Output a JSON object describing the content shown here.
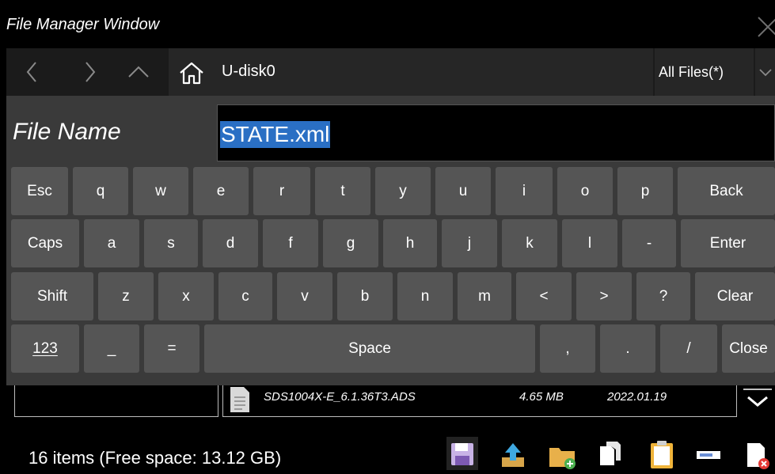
{
  "window": {
    "title": "File Manager Window",
    "close_icon": "close-icon"
  },
  "nav": {
    "back_icon": "chevron-left-icon",
    "forward_icon": "chevron-right-icon",
    "up_icon": "chevron-up-icon",
    "home_icon": "home-icon",
    "path": "U-disk0",
    "filter": "All Files(*)",
    "filter_icon": "chevron-down-icon"
  },
  "file_name": {
    "label": "File Name",
    "value": "STATE.xml"
  },
  "keyboard": {
    "row1": [
      "Esc",
      "q",
      "w",
      "e",
      "r",
      "t",
      "y",
      "u",
      "i",
      "o",
      "p",
      "Back"
    ],
    "row2": [
      "Caps",
      "a",
      "s",
      "d",
      "f",
      "g",
      "h",
      "j",
      "k",
      "l",
      "-",
      "Enter"
    ],
    "row3": [
      "Shift",
      "z",
      "x",
      "c",
      "v",
      "b",
      "n",
      "m",
      "<",
      ">",
      "?",
      "Clear"
    ],
    "row4": [
      "123",
      "_",
      "=",
      "Space",
      ",",
      ".",
      "/",
      "Close"
    ]
  },
  "file_list": {
    "row": {
      "name": "SDS1004X-E_6.1.36T3.ADS",
      "size": "4.65 MB",
      "date": "2022.01.19"
    }
  },
  "status": {
    "text": "16 items (Free space: 13.12 GB)"
  },
  "toolbar": {
    "icons": [
      "save-icon",
      "upload-icon",
      "new-folder-icon",
      "copy-icon",
      "paste-icon",
      "rename-icon",
      "delete-icon"
    ]
  },
  "colors": {
    "selection": "#2a6fc4",
    "key": "#555555",
    "panel": "#3a3a3a",
    "nav": "#1b1b1b"
  }
}
